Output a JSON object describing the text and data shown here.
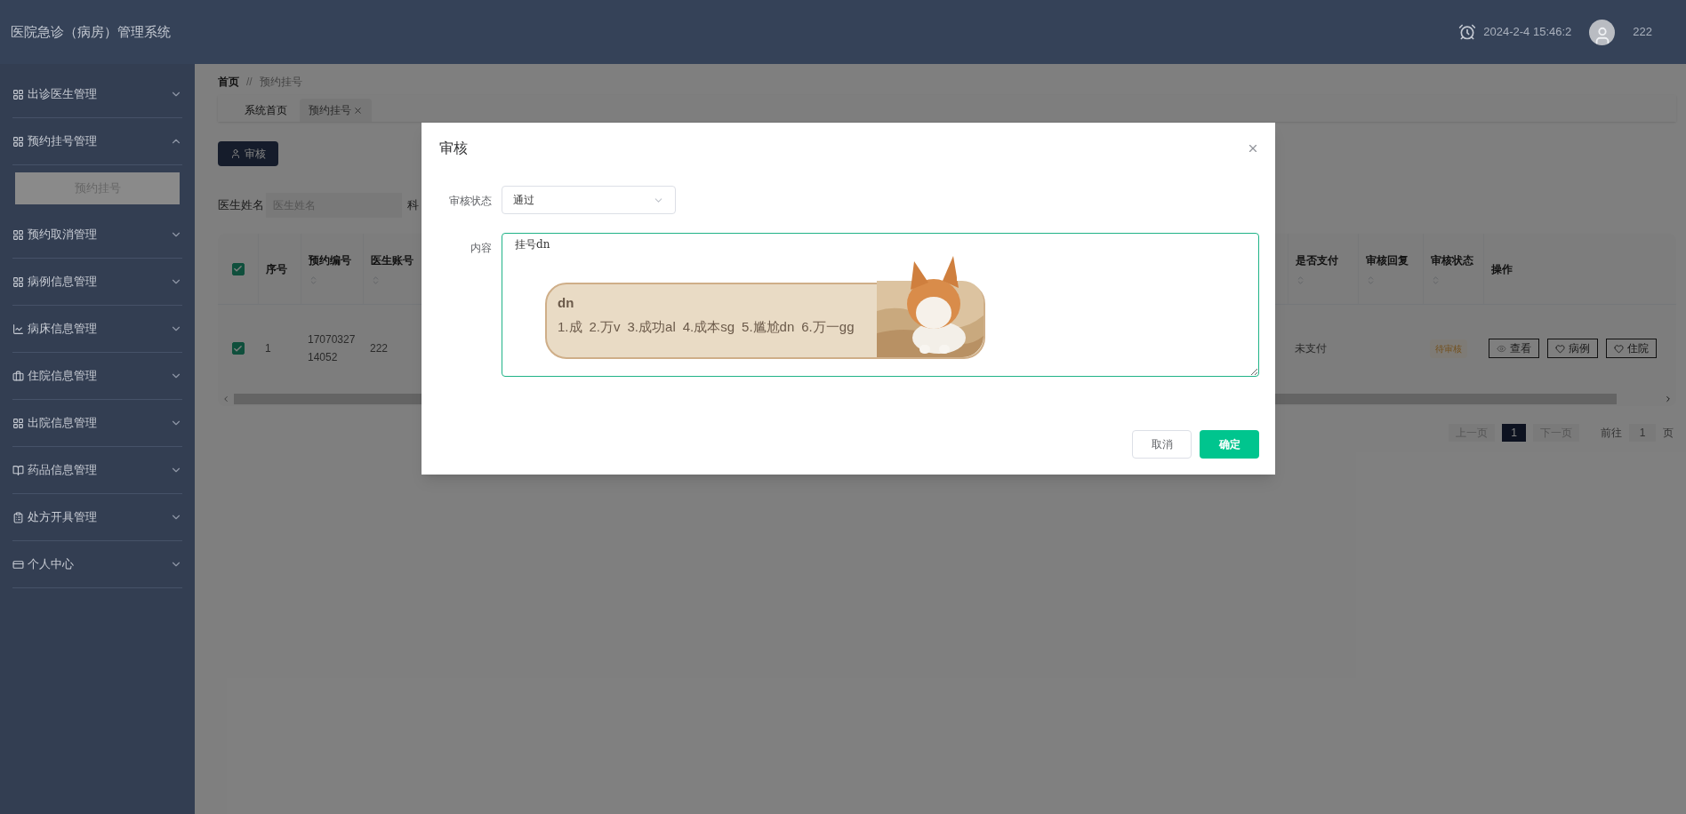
{
  "app_title": "医院急诊（病房）管理系统",
  "header": {
    "datetime": "2024-2-4 15:46:2",
    "username": "222"
  },
  "sidebar": {
    "items": [
      {
        "label": "出诊医生管理",
        "expanded": false
      },
      {
        "label": "预约挂号管理",
        "expanded": true,
        "children": [
          {
            "label": "预约挂号",
            "selected": true
          }
        ]
      },
      {
        "label": "预约取消管理",
        "expanded": false
      },
      {
        "label": "病例信息管理",
        "expanded": false
      },
      {
        "label": "病床信息管理",
        "expanded": false
      },
      {
        "label": "住院信息管理",
        "expanded": false
      },
      {
        "label": "出院信息管理",
        "expanded": false
      },
      {
        "label": "药品信息管理",
        "expanded": false
      },
      {
        "label": "处方开具管理",
        "expanded": false
      },
      {
        "label": "个人中心",
        "expanded": false
      }
    ]
  },
  "breadcrumb": {
    "items": [
      "首页",
      "预约挂号"
    ],
    "separator": "//"
  },
  "tabs": [
    {
      "label": "系统首页",
      "selected": false,
      "closable": false
    },
    {
      "label": "预约挂号",
      "selected": true,
      "closable": true
    }
  ],
  "toolbar": {
    "audit_button": "审核"
  },
  "filters": [
    {
      "label": "医生姓名",
      "placeholder": "医生姓名"
    },
    {
      "label": "科"
    }
  ],
  "table": {
    "header_checked": true,
    "columns": [
      {
        "label": "序号",
        "sortable": false
      },
      {
        "label": "预约编号",
        "sortable": true
      },
      {
        "label": "医生账号",
        "sortable": true
      },
      {
        "label": "是否支付",
        "sortable": true
      },
      {
        "label": "审核回复",
        "sortable": true
      },
      {
        "label": "审核状态",
        "sortable": true
      },
      {
        "label": "操作",
        "sortable": false
      }
    ],
    "rows": [
      {
        "checked": true,
        "index": "1",
        "booking_no": "1707032714052",
        "doctor_account": "222",
        "paid": "未支付",
        "status": "待审核",
        "actions": [
          {
            "label": "查看",
            "kind": "view"
          },
          {
            "label": "病例",
            "kind": "heart"
          },
          {
            "label": "住院",
            "kind": "heart"
          }
        ]
      }
    ]
  },
  "pagination": {
    "prev": "上一页",
    "pages": [
      {
        "label": "1",
        "selected": true
      }
    ],
    "next": "下一页",
    "goto_label": "前往",
    "goto_value": "1",
    "page_suffix": "页"
  },
  "dialog": {
    "title": "审核",
    "fields": [
      {
        "kind": "select",
        "label": "审核状态",
        "value": "通过"
      },
      {
        "kind": "textarea",
        "label": "内容",
        "value": "挂号dn",
        "focused": true
      }
    ],
    "buttons": [
      {
        "label": "取消",
        "kind": "secondary"
      },
      {
        "label": "确定",
        "kind": "primary"
      }
    ]
  },
  "ime": {
    "composition": "dn",
    "candidates": [
      "1.成",
      "2.万v",
      "3.成功al",
      "4.成本sg",
      "5.尴尬dn",
      "6.万一gg"
    ]
  }
}
